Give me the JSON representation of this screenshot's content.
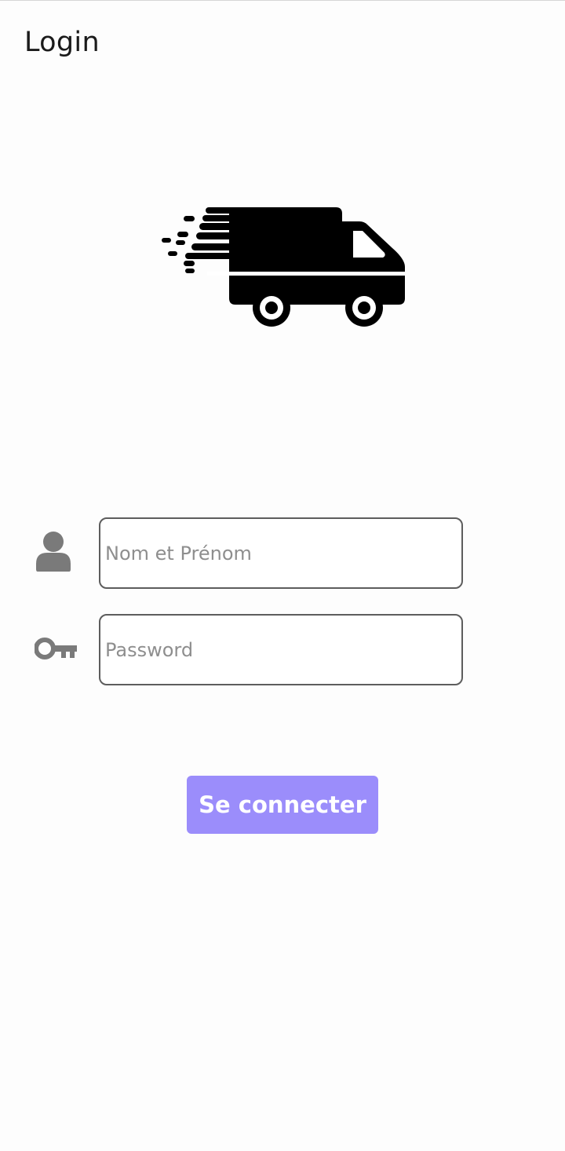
{
  "header": {
    "title": "Login"
  },
  "logo": {
    "icon": "delivery-truck-icon",
    "color": "#000000"
  },
  "form": {
    "name_field": {
      "icon": "user-icon",
      "placeholder": "Nom et Prénom",
      "value": ""
    },
    "password_field": {
      "icon": "key-icon",
      "placeholder": "Password",
      "value": ""
    },
    "submit_label": "Se connecter"
  },
  "colors": {
    "button_background": "#9b8dfb",
    "button_text": "#ffffff",
    "field_border": "#5d5d5d",
    "icon_gray": "#7a7a7a",
    "placeholder": "#8e8e8e"
  }
}
